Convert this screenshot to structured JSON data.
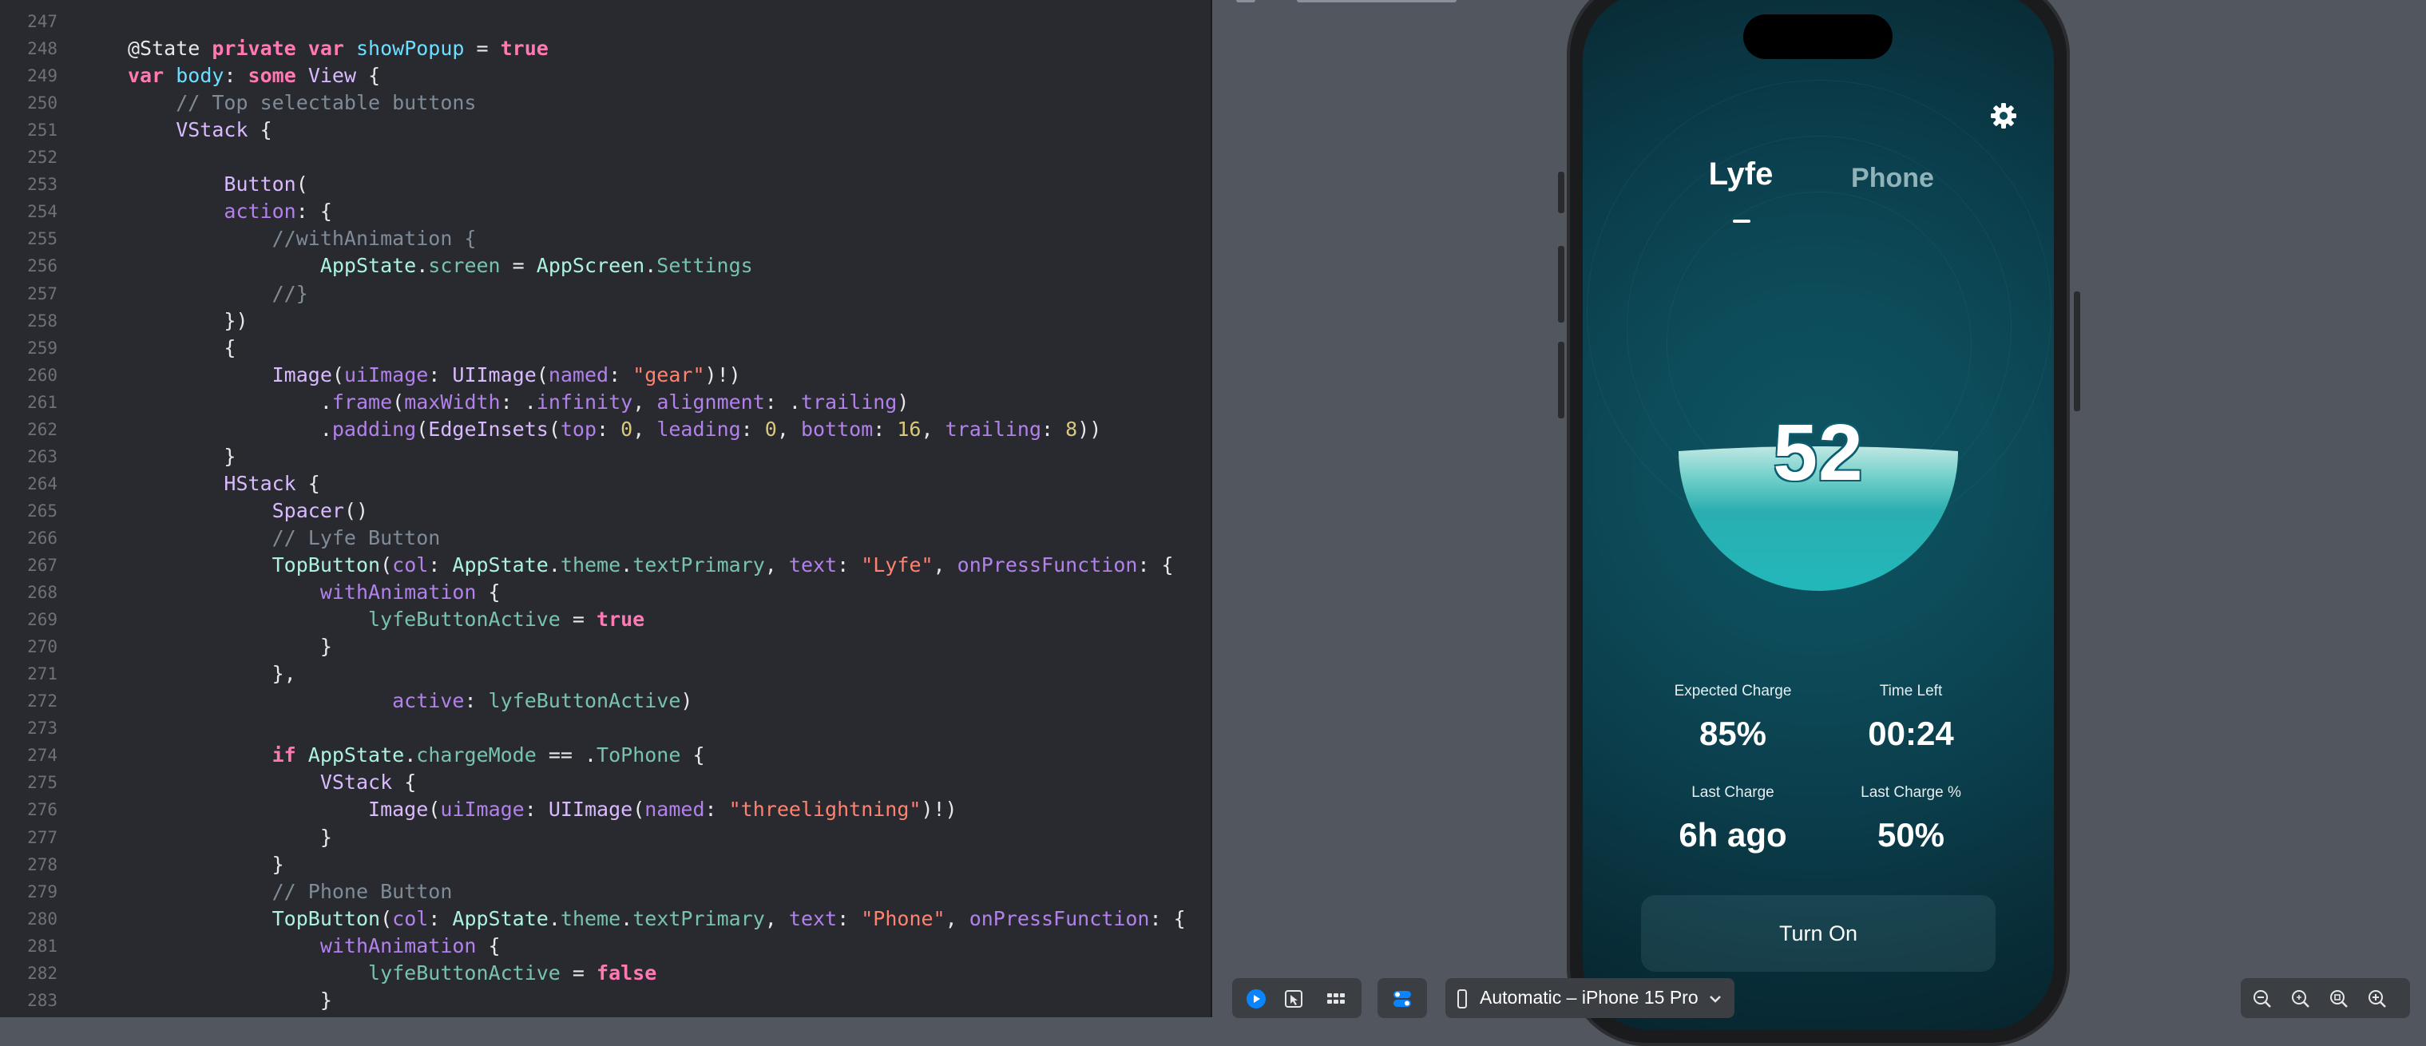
{
  "editor": {
    "lines": [
      {
        "n": "247",
        "tokens": []
      },
      {
        "n": "248",
        "tokens": [
          [
            "c-attr",
            "@State "
          ],
          [
            "c-kw",
            "private var "
          ],
          [
            "c-var",
            "showPopup"
          ],
          [
            "c-attr",
            " = "
          ],
          [
            "c-kw",
            "true"
          ]
        ]
      },
      {
        "n": "249",
        "tokens": [
          [
            "c-kw",
            "var "
          ],
          [
            "c-var",
            "body"
          ],
          [
            "c-attr",
            ": "
          ],
          [
            "c-kw",
            "some "
          ],
          [
            "c-ty",
            "View"
          ],
          [
            "c-attr",
            " {"
          ]
        ]
      },
      {
        "n": "250",
        "tokens": [
          [
            "c-cm",
            "    // Top selectable buttons"
          ]
        ]
      },
      {
        "n": "251",
        "tokens": [
          [
            "c-ty",
            "    VStack"
          ],
          [
            "c-attr",
            " {"
          ]
        ]
      },
      {
        "n": "252",
        "tokens": []
      },
      {
        "n": "253",
        "tokens": [
          [
            "c-ty",
            "        Button"
          ],
          [
            "c-attr",
            "("
          ]
        ]
      },
      {
        "n": "254",
        "tokens": [
          [
            "c-fn",
            "        action"
          ],
          [
            "c-attr",
            ": {"
          ]
        ]
      },
      {
        "n": "255",
        "tokens": [
          [
            "c-cm",
            "            //withAnimation {"
          ]
        ]
      },
      {
        "n": "256",
        "tokens": [
          [
            "c-cls",
            "                AppState"
          ],
          [
            "c-attr",
            "."
          ],
          [
            "c-ty2",
            "screen"
          ],
          [
            "c-attr",
            " = "
          ],
          [
            "c-cls",
            "AppScreen"
          ],
          [
            "c-attr",
            "."
          ],
          [
            "c-ty2",
            "Settings"
          ]
        ]
      },
      {
        "n": "257",
        "tokens": [
          [
            "c-cm",
            "            //}"
          ]
        ]
      },
      {
        "n": "258",
        "tokens": [
          [
            "c-attr",
            "        })"
          ]
        ]
      },
      {
        "n": "259",
        "tokens": [
          [
            "c-attr",
            "        {"
          ]
        ]
      },
      {
        "n": "260",
        "tokens": [
          [
            "c-ty",
            "            Image"
          ],
          [
            "c-attr",
            "("
          ],
          [
            "c-fn",
            "uiImage"
          ],
          [
            "c-attr",
            ": "
          ],
          [
            "c-ty",
            "UIImage"
          ],
          [
            "c-attr",
            "("
          ],
          [
            "c-fn",
            "named"
          ],
          [
            "c-attr",
            ": "
          ],
          [
            "c-str",
            "\"gear\""
          ],
          [
            "c-attr",
            ")!)"
          ]
        ]
      },
      {
        "n": "261",
        "tokens": [
          [
            "c-attr",
            "                ."
          ],
          [
            "c-fn",
            "frame"
          ],
          [
            "c-attr",
            "("
          ],
          [
            "c-fn",
            "maxWidth"
          ],
          [
            "c-attr",
            ": ."
          ],
          [
            "c-fn",
            "infinity"
          ],
          [
            "c-attr",
            ", "
          ],
          [
            "c-fn",
            "alignment"
          ],
          [
            "c-attr",
            ": ."
          ],
          [
            "c-fn",
            "trailing"
          ],
          [
            "c-attr",
            ")"
          ]
        ]
      },
      {
        "n": "262",
        "tokens": [
          [
            "c-attr",
            "                ."
          ],
          [
            "c-fn",
            "padding"
          ],
          [
            "c-attr",
            "("
          ],
          [
            "c-ty",
            "EdgeInsets"
          ],
          [
            "c-attr",
            "("
          ],
          [
            "c-fn",
            "top"
          ],
          [
            "c-attr",
            ": "
          ],
          [
            "c-num",
            "0"
          ],
          [
            "c-attr",
            ", "
          ],
          [
            "c-fn",
            "leading"
          ],
          [
            "c-attr",
            ": "
          ],
          [
            "c-num",
            "0"
          ],
          [
            "c-attr",
            ", "
          ],
          [
            "c-fn",
            "bottom"
          ],
          [
            "c-attr",
            ": "
          ],
          [
            "c-num",
            "16"
          ],
          [
            "c-attr",
            ", "
          ],
          [
            "c-fn",
            "trailing"
          ],
          [
            "c-attr",
            ": "
          ],
          [
            "c-num",
            "8"
          ],
          [
            "c-attr",
            "))"
          ]
        ]
      },
      {
        "n": "263",
        "tokens": [
          [
            "c-attr",
            "        }"
          ]
        ]
      },
      {
        "n": "264",
        "tokens": [
          [
            "c-ty",
            "        HStack"
          ],
          [
            "c-attr",
            " {"
          ]
        ]
      },
      {
        "n": "265",
        "tokens": [
          [
            "c-ty",
            "            Spacer"
          ],
          [
            "c-attr",
            "()"
          ]
        ]
      },
      {
        "n": "266",
        "tokens": [
          [
            "c-cm",
            "            // Lyfe Button"
          ]
        ]
      },
      {
        "n": "267",
        "tokens": [
          [
            "c-cls",
            "            TopButton"
          ],
          [
            "c-attr",
            "("
          ],
          [
            "c-fn",
            "col"
          ],
          [
            "c-attr",
            ": "
          ],
          [
            "c-cls",
            "AppState"
          ],
          [
            "c-attr",
            "."
          ],
          [
            "c-ty2",
            "theme"
          ],
          [
            "c-attr",
            "."
          ],
          [
            "c-ty2",
            "textPrimary"
          ],
          [
            "c-attr",
            ", "
          ],
          [
            "c-fn",
            "text"
          ],
          [
            "c-attr",
            ": "
          ],
          [
            "c-str",
            "\"Lyfe\""
          ],
          [
            "c-attr",
            ", "
          ],
          [
            "c-fn",
            "onPressFunction"
          ],
          [
            "c-attr",
            ": {"
          ]
        ]
      },
      {
        "n": "268",
        "tokens": [
          [
            "c-fn",
            "                withAnimation"
          ],
          [
            "c-attr",
            " {"
          ]
        ]
      },
      {
        "n": "269",
        "tokens": [
          [
            "c-ty2",
            "                    lyfeButtonActive"
          ],
          [
            "c-attr",
            " = "
          ],
          [
            "c-kw",
            "true"
          ]
        ]
      },
      {
        "n": "270",
        "tokens": [
          [
            "c-attr",
            "                }"
          ]
        ]
      },
      {
        "n": "271",
        "tokens": [
          [
            "c-attr",
            "            },"
          ]
        ]
      },
      {
        "n": "272",
        "tokens": [
          [
            "c-fn",
            "                      active"
          ],
          [
            "c-attr",
            ": "
          ],
          [
            "c-ty2",
            "lyfeButtonActive"
          ],
          [
            "c-attr",
            ")"
          ]
        ]
      },
      {
        "n": "273",
        "tokens": []
      },
      {
        "n": "274",
        "tokens": [
          [
            "c-kw",
            "            if "
          ],
          [
            "c-cls",
            "AppState"
          ],
          [
            "c-attr",
            "."
          ],
          [
            "c-ty2",
            "chargeMode"
          ],
          [
            "c-attr",
            " == ."
          ],
          [
            "c-ty2",
            "ToPhone"
          ],
          [
            "c-attr",
            " {"
          ]
        ]
      },
      {
        "n": "275",
        "tokens": [
          [
            "c-ty",
            "                VStack"
          ],
          [
            "c-attr",
            " {"
          ]
        ]
      },
      {
        "n": "276",
        "tokens": [
          [
            "c-ty",
            "                    Image"
          ],
          [
            "c-attr",
            "("
          ],
          [
            "c-fn",
            "uiImage"
          ],
          [
            "c-attr",
            ": "
          ],
          [
            "c-ty",
            "UIImage"
          ],
          [
            "c-attr",
            "("
          ],
          [
            "c-fn",
            "named"
          ],
          [
            "c-attr",
            ": "
          ],
          [
            "c-str",
            "\"threelightning\""
          ],
          [
            "c-attr",
            ")!)"
          ]
        ]
      },
      {
        "n": "277",
        "tokens": [
          [
            "c-attr",
            "                }"
          ]
        ]
      },
      {
        "n": "278",
        "tokens": [
          [
            "c-attr",
            "            }"
          ]
        ]
      },
      {
        "n": "279",
        "tokens": [
          [
            "c-cm",
            "            // Phone Button"
          ]
        ]
      },
      {
        "n": "280",
        "tokens": [
          [
            "c-cls",
            "            TopButton"
          ],
          [
            "c-attr",
            "("
          ],
          [
            "c-fn",
            "col"
          ],
          [
            "c-attr",
            ": "
          ],
          [
            "c-cls",
            "AppState"
          ],
          [
            "c-attr",
            "."
          ],
          [
            "c-ty2",
            "theme"
          ],
          [
            "c-attr",
            "."
          ],
          [
            "c-ty2",
            "textPrimary"
          ],
          [
            "c-attr",
            ", "
          ],
          [
            "c-fn",
            "text"
          ],
          [
            "c-attr",
            ": "
          ],
          [
            "c-str",
            "\"Phone\""
          ],
          [
            "c-attr",
            ", "
          ],
          [
            "c-fn",
            "onPressFunction"
          ],
          [
            "c-attr",
            ": {"
          ]
        ]
      },
      {
        "n": "281",
        "tokens": [
          [
            "c-fn",
            "                withAnimation"
          ],
          [
            "c-attr",
            " {"
          ]
        ]
      },
      {
        "n": "282",
        "tokens": [
          [
            "c-ty2",
            "                    lyfeButtonActive"
          ],
          [
            "c-attr",
            " = "
          ],
          [
            "c-kw",
            "false"
          ]
        ]
      },
      {
        "n": "283",
        "tokens": [
          [
            "c-attr",
            "                }"
          ]
        ]
      }
    ]
  },
  "preview": {
    "tabs": {
      "lyfe": "Lyfe",
      "phone": "Phone"
    },
    "charge_value": "52",
    "charge_fill_percent": 52,
    "stats": {
      "expected_charge_label": "Expected Charge",
      "expected_charge_value": "85%",
      "time_left_label": "Time Left",
      "time_left_value": "00:24",
      "last_charge_label": "Last Charge",
      "last_charge_value": "6h ago",
      "last_charge_pct_label": "Last Charge %",
      "last_charge_pct_value": "50%"
    },
    "turn_on_label": "Turn On",
    "gauge_color": "#29b4b6"
  },
  "toolbar": {
    "device_label": "Automatic – iPhone 15 Pro"
  },
  "colors": {
    "editor_bg": "#292a30",
    "preview_bg": "#52575f",
    "accent_blue": "#0a84ff"
  }
}
